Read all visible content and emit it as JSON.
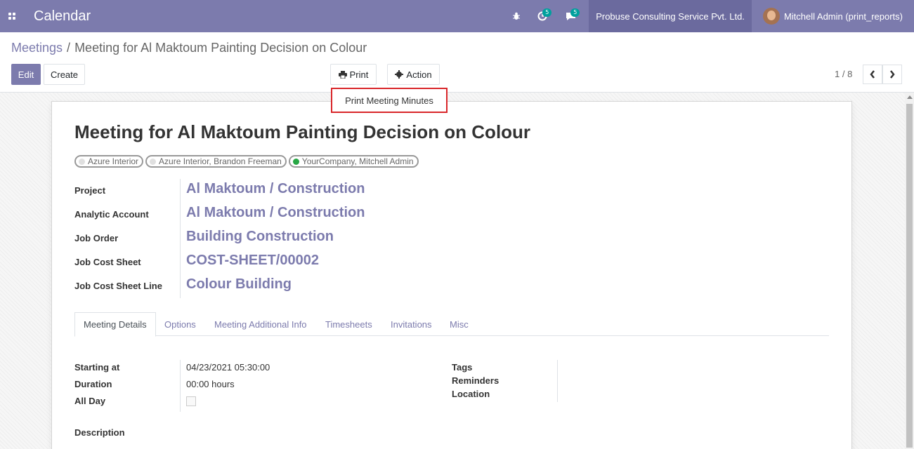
{
  "navbar": {
    "app_title": "Calendar",
    "activity_count": "5",
    "messages_count": "5",
    "company": "Probuse Consulting Service Pvt. Ltd.",
    "user": "Mitchell Admin (print_reports)"
  },
  "breadcrumb": {
    "parent": "Meetings",
    "separator": "/",
    "current": "Meeting for Al Maktoum Painting Decision on Colour"
  },
  "toolbar": {
    "edit_label": "Edit",
    "create_label": "Create",
    "print_label": "Print",
    "action_label": "Action",
    "pager": "1 / 8"
  },
  "print_menu": {
    "items": [
      "Print Meeting Minutes"
    ]
  },
  "record": {
    "title": "Meeting for Al Maktoum Painting Decision on Colour",
    "attendees": [
      "Azure Interior",
      "Azure Interior, Brandon Freeman",
      "YourCompany, Mitchell Admin"
    ],
    "fields": [
      {
        "label": "Project",
        "value": "Al Maktoum / Construction"
      },
      {
        "label": "Analytic Account",
        "value": "Al Maktoum / Construction"
      },
      {
        "label": "Job Order",
        "value": "Building Construction"
      },
      {
        "label": "Job Cost Sheet",
        "value": "COST-SHEET/00002"
      },
      {
        "label": "Job Cost Sheet Line",
        "value": "Colour Building"
      }
    ]
  },
  "tabs": [
    "Meeting Details",
    "Options",
    "Meeting Additional Info",
    "Timesheets",
    "Invitations",
    "Misc"
  ],
  "details": {
    "starting_at_label": "Starting at",
    "starting_at_value": "04/23/2021 05:30:00",
    "duration_label": "Duration",
    "duration_value": "00:00 hours",
    "all_day_label": "All Day",
    "all_day_checked": false,
    "tags_label": "Tags",
    "reminders_label": "Reminders",
    "location_label": "Location",
    "description_label": "Description"
  },
  "colors": {
    "brand": "#7c7bad",
    "highlight_border": "#d9262a"
  }
}
